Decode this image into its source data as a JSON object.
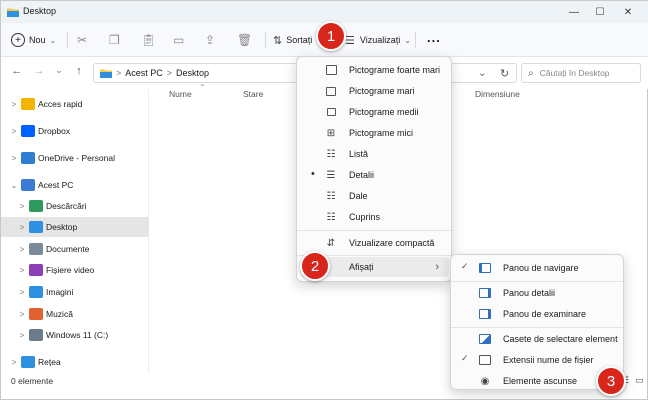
{
  "window": {
    "title": "Desktop",
    "controls": [
      "—",
      "☐",
      "✕"
    ]
  },
  "commandbar": {
    "new_label": "Nou",
    "sort_label": "Sortați",
    "view_label": "Vizualizați",
    "more_label": "..."
  },
  "address": {
    "back": "←",
    "forward": "→",
    "history": "⌄",
    "up": "↑",
    "path_root": "Acest PC",
    "path_sep": ">",
    "path_current": "Desktop",
    "refresh": "↻",
    "search_placeholder": "Căutați în Desktop"
  },
  "columns": {
    "name": "Nume",
    "status": "Stare",
    "size": "Dimensiune"
  },
  "sidebar": {
    "items": [
      {
        "label": "Acces rapid",
        "color": "#f5b400",
        "chev": ">"
      },
      {
        "label": "Dropbox",
        "color": "#0061fe",
        "chev": ">"
      },
      {
        "label": "OneDrive - Personal",
        "color": "#2d7dd2",
        "chev": ">"
      },
      {
        "label": "Acest PC",
        "color": "#3a7bd5",
        "chev": "⌄"
      },
      {
        "label": "Descărcări",
        "color": "#2e9a5e",
        "chev": ">"
      },
      {
        "label": "Desktop",
        "color": "#2f8fe0",
        "chev": ">"
      },
      {
        "label": "Documente",
        "color": "#7b8a99",
        "chev": ">"
      },
      {
        "label": "Fișiere video",
        "color": "#8a3fb8",
        "chev": ">"
      },
      {
        "label": "Imagini",
        "color": "#2f8fe0",
        "chev": ">"
      },
      {
        "label": "Muzică",
        "color": "#e0632f",
        "chev": ">"
      },
      {
        "label": "Windows 11 (C:)",
        "color": "#6b7b8b",
        "chev": ">"
      },
      {
        "label": "Rețea",
        "color": "#2f8fe0",
        "chev": ">"
      }
    ]
  },
  "status": {
    "count": "0 elemente"
  },
  "view_menu": {
    "items": [
      {
        "label": "Pictograme foarte mari",
        "icon": "monitor-icon"
      },
      {
        "label": "Pictograme mari",
        "icon": "monitor-icon"
      },
      {
        "label": "Pictograme medii",
        "icon": "monitor-icon"
      },
      {
        "label": "Pictograme mici",
        "icon": "grid-icon"
      },
      {
        "label": "Listă",
        "icon": "list-icon"
      },
      {
        "label": "Detalii",
        "icon": "details-icon",
        "bullet": "•"
      },
      {
        "label": "Dale",
        "icon": "tiles-icon"
      },
      {
        "label": "Cuprins",
        "icon": "content-icon"
      },
      {
        "label": "Vizualizare compactă",
        "icon": "compact-icon"
      },
      {
        "label": "Afișați",
        "icon": "",
        "submenu": "›"
      }
    ]
  },
  "show_menu": {
    "items": [
      {
        "label": "Panou de navigare",
        "check": "✓"
      },
      {
        "label": "Panou detalii",
        "check": ""
      },
      {
        "label": "Panou de examinare",
        "check": ""
      },
      {
        "label": "Casete de selectare element",
        "check": ""
      },
      {
        "label": "Extensii nume de fișier",
        "check": "✓"
      },
      {
        "label": "Elemente ascunse",
        "check": ""
      }
    ]
  },
  "badges": {
    "one": "1",
    "two": "2",
    "three": "3"
  },
  "colors": {
    "accent": "#0067c0",
    "badge": "#d9261c"
  }
}
